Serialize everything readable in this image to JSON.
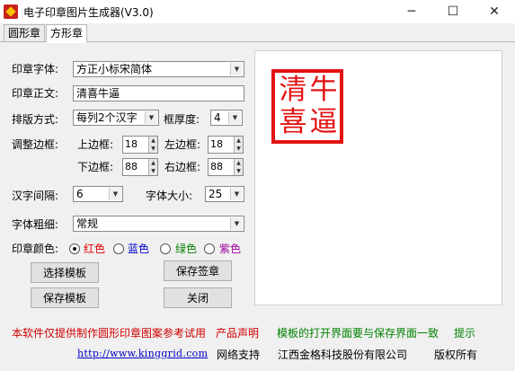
{
  "window": {
    "title": "电子印章图片生成器(V3.0)",
    "minimize": "─",
    "maximize": "☐",
    "close": "✕"
  },
  "tabs": [
    {
      "label": "圆形章",
      "active": false
    },
    {
      "label": "方形章",
      "active": true
    }
  ],
  "form": {
    "font_label": "印章字体:",
    "font_value": "方正小标宋简体",
    "text_label": "印章正文:",
    "text_value": "清喜牛逼",
    "layout_label": "排版方式:",
    "layout_value": "每列2个汉字",
    "frame_label": "框厚度:",
    "frame_value": "4",
    "margin_label": "调整边框:",
    "top_label": "上边框:",
    "top_value": "18",
    "left_label": "左边框:",
    "left_value": "18",
    "bottom_label": "下边框:",
    "bottom_value": "88",
    "right_label": "右边框:",
    "right_value": "88",
    "spacing_label": "汉字间隔:",
    "spacing_value": "6",
    "size_label": "字体大小:",
    "size_value": "25",
    "weight_label": "字体粗细:",
    "weight_value": "常规",
    "color_label": "印章颜色:",
    "colors": [
      {
        "label": "红色",
        "color": "#e00000",
        "checked": true
      },
      {
        "label": "蓝色",
        "color": "#0000d0",
        "checked": false
      },
      {
        "label": "绿色",
        "color": "#008000",
        "checked": false
      },
      {
        "label": "紫色",
        "color": "#a000a0",
        "checked": false
      }
    ]
  },
  "buttons": {
    "select_template": "选择模板",
    "save_stamp": "保存签章",
    "save_template": "保存模板",
    "close": "关闭"
  },
  "stamp": {
    "color": "#e31212",
    "chars": [
      "清",
      "牛",
      "喜",
      "逼"
    ]
  },
  "footer": {
    "notice": "本软件仅提供制作圆形印章图案参考试用",
    "product_statement": "产品声明",
    "template_tip": "模板的打开界面要与保存界面一致",
    "tip": "提示",
    "url": "http://www.kinggrid.com",
    "network_support": "网络支持",
    "company": "江西金格科技股份有限公司",
    "copyright": "版权所有"
  }
}
